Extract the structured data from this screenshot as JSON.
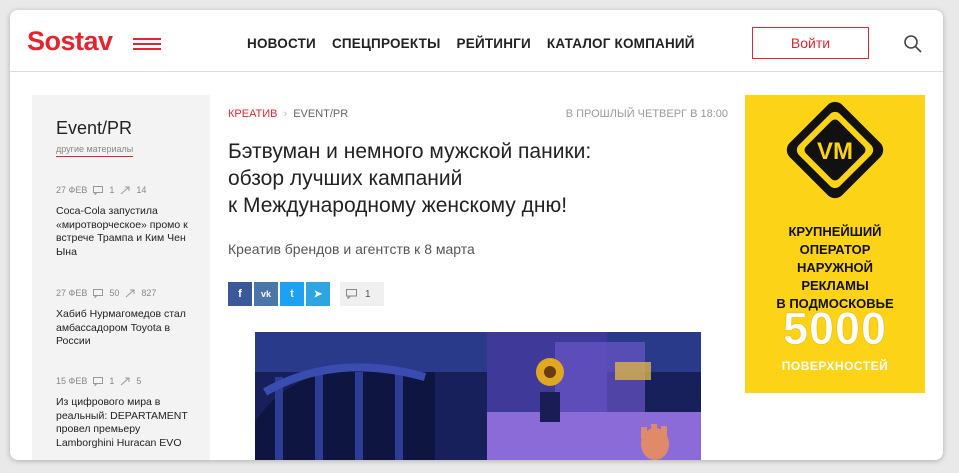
{
  "brand": {
    "logo": "Sostav",
    "accent": "#e4252f"
  },
  "nav": {
    "items": [
      "НОВОСТИ",
      "СПЕЦПРОЕКТЫ",
      "РЕЙТИНГИ",
      "КАТАЛОГ КОМПАНИЙ"
    ]
  },
  "header": {
    "login_label": "Войти",
    "icons": [
      "menu-icon",
      "search-icon"
    ]
  },
  "sidebar": {
    "title": "Event/PR",
    "subtitle": "другие материалы",
    "items": [
      {
        "date": "27 ФЕВ",
        "comments": "1",
        "views": "14",
        "title": "Coca-Cola запустила «миротворческое» промо к встрече Трампа и Ким Чен Ына"
      },
      {
        "date": "27 ФЕВ",
        "comments": "50",
        "views": "827",
        "title": "Хабиб Нурмагомедов стал амбассадором Toyota в России"
      },
      {
        "date": "15 ФЕВ",
        "comments": "1",
        "views": "5",
        "title": "Из цифрового мира в реальный: DEPARTAMENT провел премьеру Lamborghini Huracan EVO"
      }
    ]
  },
  "article": {
    "category": "КРЕАТИВ",
    "subcategory": "EVENT/PR",
    "date": "В ПРОШЛЫЙ ЧЕТВЕРГ В 18:00",
    "headline_lines": [
      "Бэтвуман и немного мужской паники:",
      "обзор лучших кампаний",
      "к Международному женскому дню!"
    ],
    "lead": "Креатив брендов и агентств к 8 марта",
    "comments_count": "1",
    "share": [
      {
        "name": "facebook",
        "glyph": "f",
        "color": "#3b5998"
      },
      {
        "name": "vk",
        "glyph": "vk",
        "color": "#4a76a8"
      },
      {
        "name": "twitter",
        "glyph": "t",
        "color": "#1da1f2"
      },
      {
        "name": "telegram",
        "glyph": "➤",
        "color": "#2ca5e0"
      }
    ]
  },
  "ad": {
    "logo": "VM",
    "lines": [
      "КРУПНЕЙШИЙ",
      "ОПЕРАТОР",
      "НАРУЖНОЙ",
      "РЕКЛАМЫ",
      "В ПОДМОСКОВЬЕ"
    ],
    "number": "5000",
    "sub": "ПОВЕРХНОСТЕЙ",
    "color": "#fcd316"
  }
}
